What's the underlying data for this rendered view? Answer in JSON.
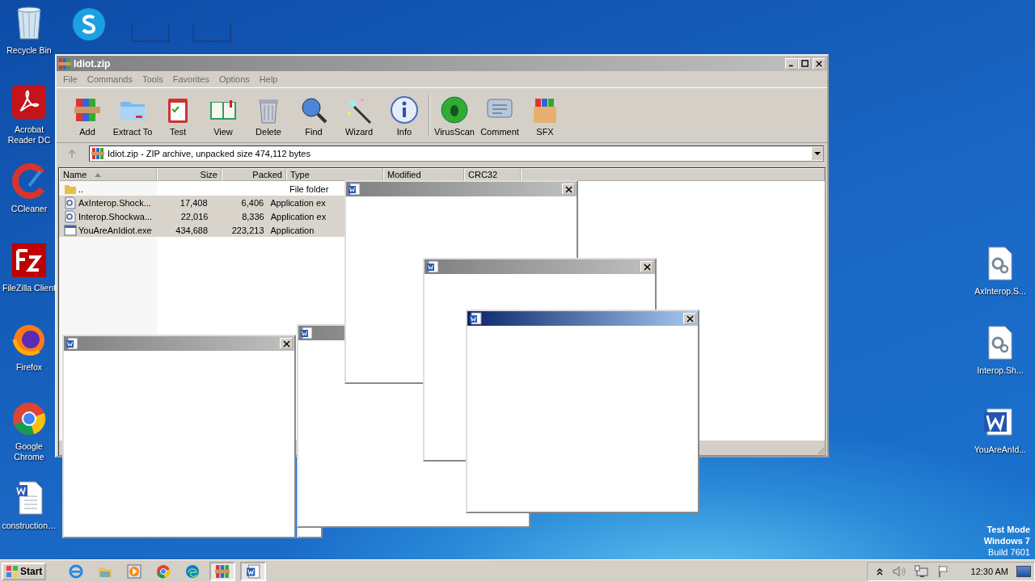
{
  "desktop": {
    "left_icons": [
      {
        "label": "Recycle Bin",
        "kind": "recycle"
      },
      {
        "label": "Acrobat\nReader DC",
        "kind": "acrobat"
      },
      {
        "label": "CCleaner",
        "kind": "ccleaner"
      },
      {
        "label": "FileZilla Client",
        "kind": "filezilla"
      },
      {
        "label": "Firefox",
        "kind": "firefox"
      },
      {
        "label": "Google\nChrome",
        "kind": "chrome"
      },
      {
        "label": "construction…",
        "kind": "worddoc"
      }
    ],
    "top_icons": [
      {
        "kind": "skype"
      },
      {
        "kind": "blank"
      },
      {
        "kind": "blank"
      }
    ],
    "right_icons": [
      {
        "label": "AxInterop.S...",
        "kind": "gears"
      },
      {
        "label": "Interop.Sh...",
        "kind": "gears"
      },
      {
        "label": "YouAreAnId...",
        "kind": "word"
      }
    ],
    "test_mode": [
      "Test Mode",
      "Windows 7",
      "Build 7601"
    ]
  },
  "archive": {
    "title": "Idiot.zip",
    "menu": [
      "File",
      "Commands",
      "Tools",
      "Favorites",
      "Options",
      "Help"
    ],
    "toolbar": [
      {
        "label": "Add",
        "kind": "add"
      },
      {
        "label": "Extract To",
        "kind": "extract"
      },
      {
        "label": "Test",
        "kind": "test"
      },
      {
        "label": "View",
        "kind": "view"
      },
      {
        "label": "Delete",
        "kind": "delete"
      },
      {
        "label": "Find",
        "kind": "find"
      },
      {
        "label": "Wizard",
        "kind": "wizard"
      },
      {
        "label": "Info",
        "kind": "info"
      },
      {
        "label": "VirusScan",
        "kind": "virus"
      },
      {
        "label": "Comment",
        "kind": "comment"
      },
      {
        "label": "SFX",
        "kind": "sfx"
      }
    ],
    "path": "Idiot.zip - ZIP archive, unpacked size 474,112 bytes",
    "columns": [
      "Name",
      "Size",
      "Packed",
      "Type",
      "Modified",
      "CRC32"
    ],
    "rows": [
      {
        "name": "..",
        "size": "",
        "packed": "",
        "type": "File folder",
        "kind": "folder",
        "selected": false
      },
      {
        "name": "AxInterop.Shock...",
        "size": "17,408",
        "packed": "6,406",
        "type": "Application ex",
        "kind": "dll",
        "selected": true
      },
      {
        "name": "Interop.Shockwa...",
        "size": "22,016",
        "packed": "8,336",
        "type": "Application ex",
        "kind": "dll",
        "selected": true
      },
      {
        "name": "YouAreAnIdiot.exe",
        "size": "434,688",
        "packed": "223,213",
        "type": "Application",
        "kind": "exe",
        "selected": true
      }
    ]
  },
  "popups": [
    {
      "active": false
    },
    {
      "active": false
    },
    {
      "active": false
    },
    {
      "active": false
    },
    {
      "active": true
    }
  ],
  "taskbar": {
    "start": "Start",
    "items": [
      {
        "kind": "ie",
        "pressed": false
      },
      {
        "kind": "explorer",
        "pressed": false
      },
      {
        "kind": "media",
        "pressed": false
      },
      {
        "kind": "chrome",
        "pressed": false
      },
      {
        "kind": "edge",
        "pressed": false
      },
      {
        "kind": "winrar",
        "pressed": true
      },
      {
        "kind": "word",
        "pressed": true
      }
    ],
    "clock": "12:30 AM"
  }
}
